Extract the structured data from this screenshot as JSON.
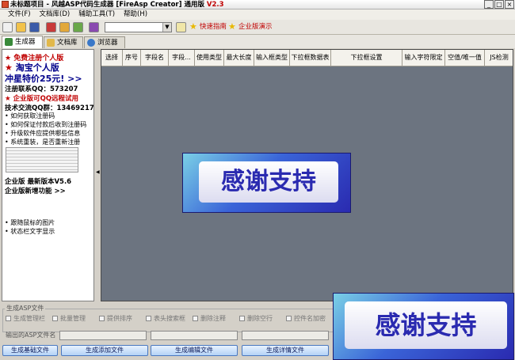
{
  "titlebar": {
    "title": "未标题项目 - 风越ASP代码生成器 [FireAsp Creator] 通用版",
    "version": "V2.3"
  },
  "window_buttons": [
    "_",
    "□",
    "×"
  ],
  "menu": [
    "文件(F)",
    "文档库(D)",
    "辅助工具(T)",
    "帮助(H)"
  ],
  "toolbar": {
    "links": [
      "快速指南",
      "企业版演示"
    ]
  },
  "tabs": [
    "生成器",
    "文档库",
    "浏览器"
  ],
  "sidebar": {
    "lines": [
      "免费注册个人版",
      "淘宝个人版",
      "冲星特价25元! >>",
      "注册联系QQ：573207",
      "企业版可QQ远程试用",
      "技术交流QQ群：13469217",
      "• 如何获取注册码",
      "• 如何保证付款后收到注册码",
      "• 升级软件应提供哪些信息",
      "• 系统重装，是否重新注册",
      "企业版 最新版本V5.6",
      "企业版新增功能 >>",
      "• 跟随鼠标的图片",
      "• 状态栏文字显示"
    ]
  },
  "grid": {
    "columns": [
      "选择",
      "序号",
      "字段名",
      "字段...",
      "使用类型",
      "最大长度",
      "输入框类型",
      "下拉框数据表",
      "下拉框设置",
      "输入字符限定",
      "空值/唯一值",
      "JS检测"
    ]
  },
  "banner_text": "感谢支持",
  "options": {
    "group_title": "生成ASP文件",
    "checkboxes": [
      "生成管理栏",
      "批量管理",
      "提供排序",
      "表头搜索框",
      "删除注释",
      "删除空行",
      "控件名加密"
    ],
    "output_label": "输出的ASP文件名",
    "buttons": [
      "生成基础文件",
      "生成添加文件",
      "生成编辑文件",
      "生成详情文件"
    ]
  }
}
